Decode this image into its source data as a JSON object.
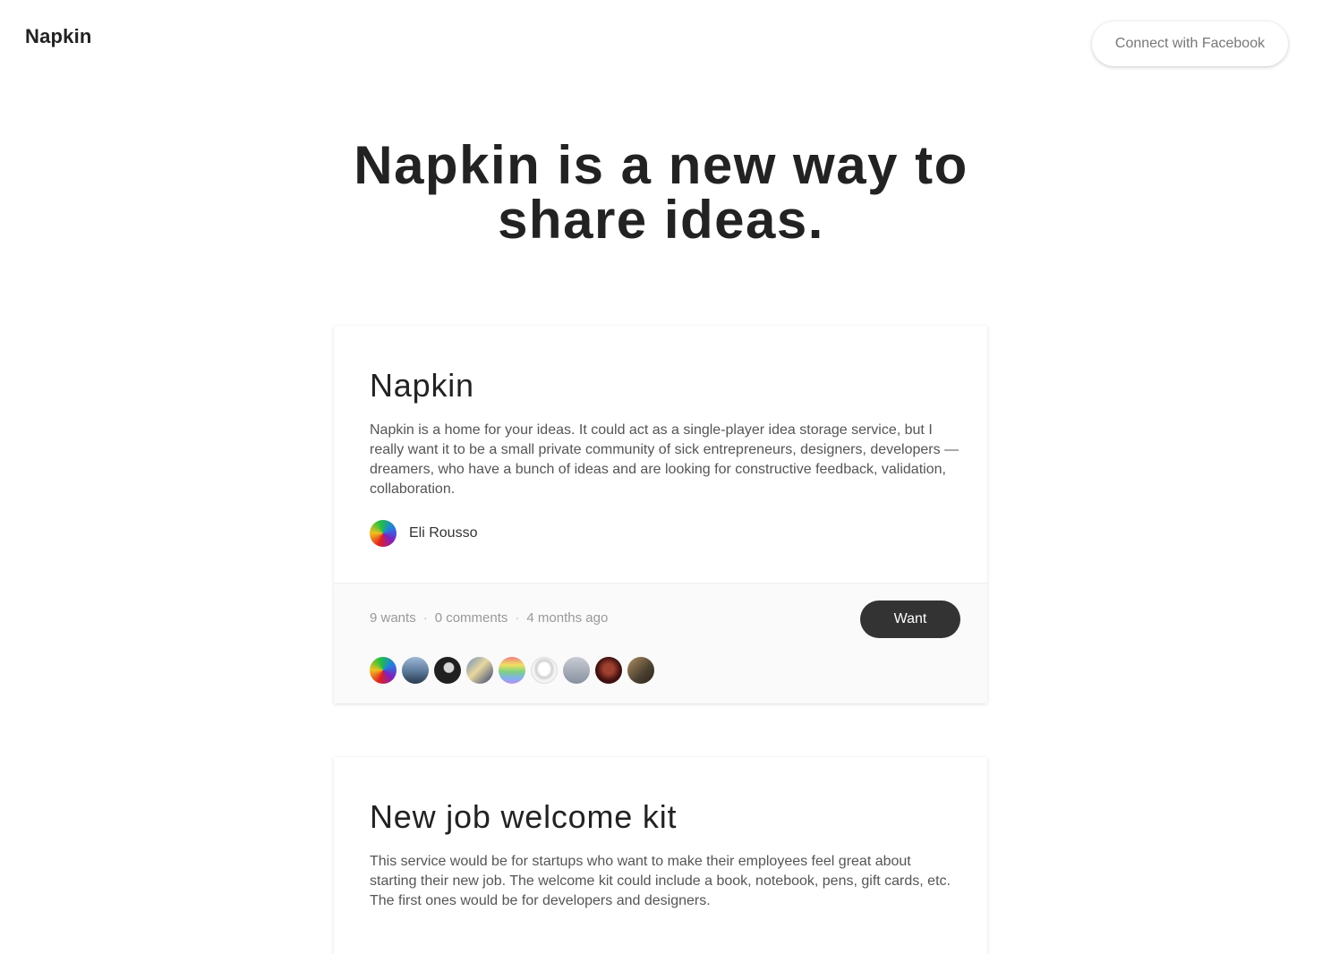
{
  "header": {
    "brand": "Napkin",
    "connect_label": "Connect with Facebook"
  },
  "hero": {
    "line1": "Napkin is a new way to",
    "line2": "share ideas."
  },
  "ideas": [
    {
      "title": "Napkin",
      "description": "Napkin is a home for your ideas. It could act as a single-player idea storage service, but I really want it to be a small private community of sick entrepreneurs, designers, developers — dreamers, who have a bunch of ideas and are looking for constructive feedback, validation, collaboration.",
      "author": "Eli Rousso",
      "wants": "9 wants",
      "comments": "0 comments",
      "age": "4 months ago",
      "want_label": "Want",
      "wanter_count": 9
    },
    {
      "title": "New job welcome kit",
      "description": "This service would be for startups who want to make their employees feel great about starting their new job. The welcome kit could include a book, notebook, pens, gift cards, etc. The first ones would be for developers and designers."
    }
  ],
  "colors": {
    "text": "#222222",
    "muted": "#999999",
    "want_button": "#333333"
  },
  "icons": {
    "avatar": "user-avatar"
  }
}
